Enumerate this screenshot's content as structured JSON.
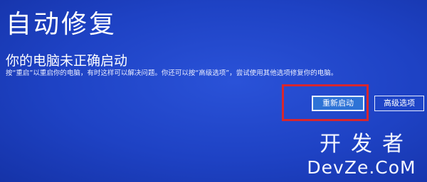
{
  "screen": {
    "title": "自动修复",
    "subtitle": "你的电脑未正确启动",
    "description": "按“重启”以重启你的电脑，有时这样可以解决问题。你还可以按“高级选项”，尝试使用其他选项修复你的电脑。",
    "background_color": "#1e42c4"
  },
  "actions": {
    "restart_label": "重新启动",
    "advanced_label": "高级选项",
    "highlight_color": "#d8262e"
  },
  "watermark": {
    "line1": "开发者",
    "line2": "DevZe.CoM"
  }
}
